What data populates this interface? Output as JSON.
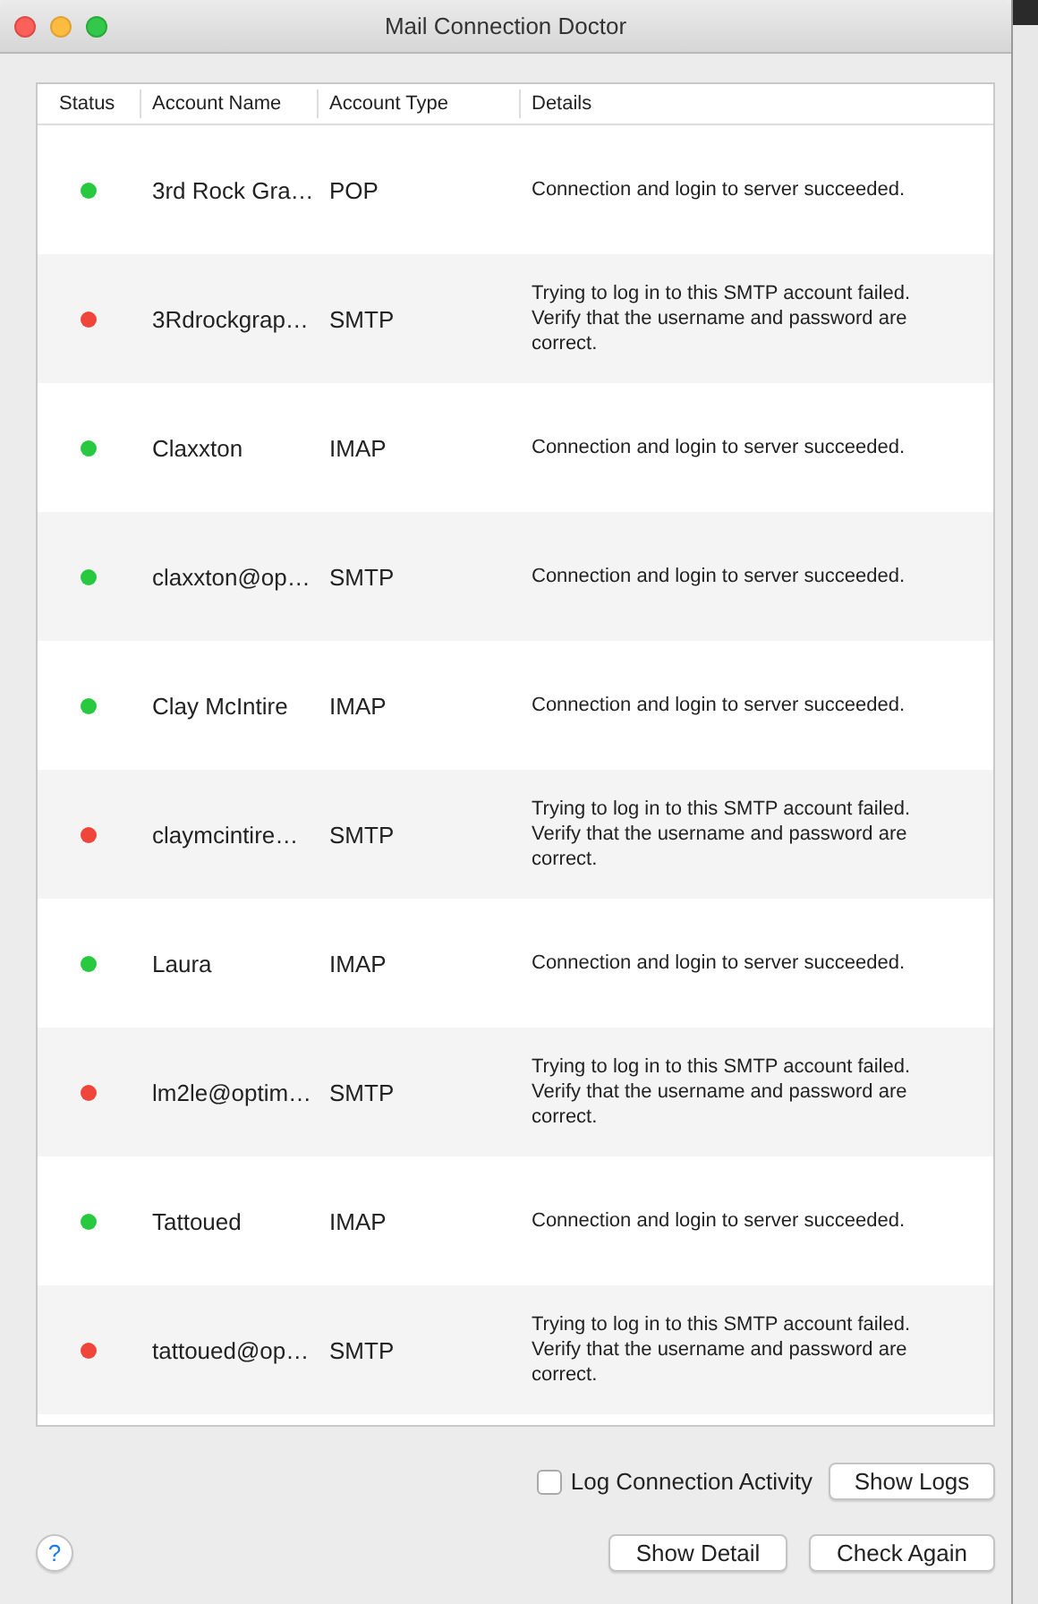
{
  "window": {
    "title": "Mail Connection Doctor"
  },
  "table": {
    "columns": [
      "Status",
      "Account Name",
      "Account Type",
      "Details"
    ],
    "rows": [
      {
        "color": "#28c840",
        "name": "3rd Rock Gra…",
        "type": "POP",
        "details": "Connection and login to server succeeded."
      },
      {
        "color": "#f0453a",
        "name": "3Rdrockgrap…",
        "type": "SMTP",
        "details": "Trying to log in to this SMTP account failed. Verify that the username and password are correct."
      },
      {
        "color": "#28c840",
        "name": "Claxxton",
        "type": "IMAP",
        "details": "Connection and login to server succeeded."
      },
      {
        "color": "#28c840",
        "name": "claxxton@op…",
        "type": "SMTP",
        "details": "Connection and login to server succeeded."
      },
      {
        "color": "#28c840",
        "name": "Clay McIntire",
        "type": "IMAP",
        "details": "Connection and login to server succeeded."
      },
      {
        "color": "#f0453a",
        "name": "claymcintire…",
        "type": "SMTP",
        "details": "Trying to log in to this SMTP account failed. Verify that the username and password are correct."
      },
      {
        "color": "#28c840",
        "name": "Laura",
        "type": "IMAP",
        "details": "Connection and login to server succeeded."
      },
      {
        "color": "#f0453a",
        "name": "lm2le@optim…",
        "type": "SMTP",
        "details": "Trying to log in to this SMTP account failed. Verify that the username and password are correct."
      },
      {
        "color": "#28c840",
        "name": "Tattoued",
        "type": "IMAP",
        "details": "Connection and login to server succeeded."
      },
      {
        "color": "#f0453a",
        "name": "tattoued@op…",
        "type": "SMTP",
        "details": "Trying to log in to this SMTP account failed. Verify that the username and password are correct."
      }
    ]
  },
  "log_checkbox": {
    "label": "Log Connection Activity",
    "checked": false
  },
  "buttons": {
    "show_logs": "Show Logs",
    "show_detail": "Show Detail",
    "check_again": "Check Again",
    "help": "?"
  }
}
